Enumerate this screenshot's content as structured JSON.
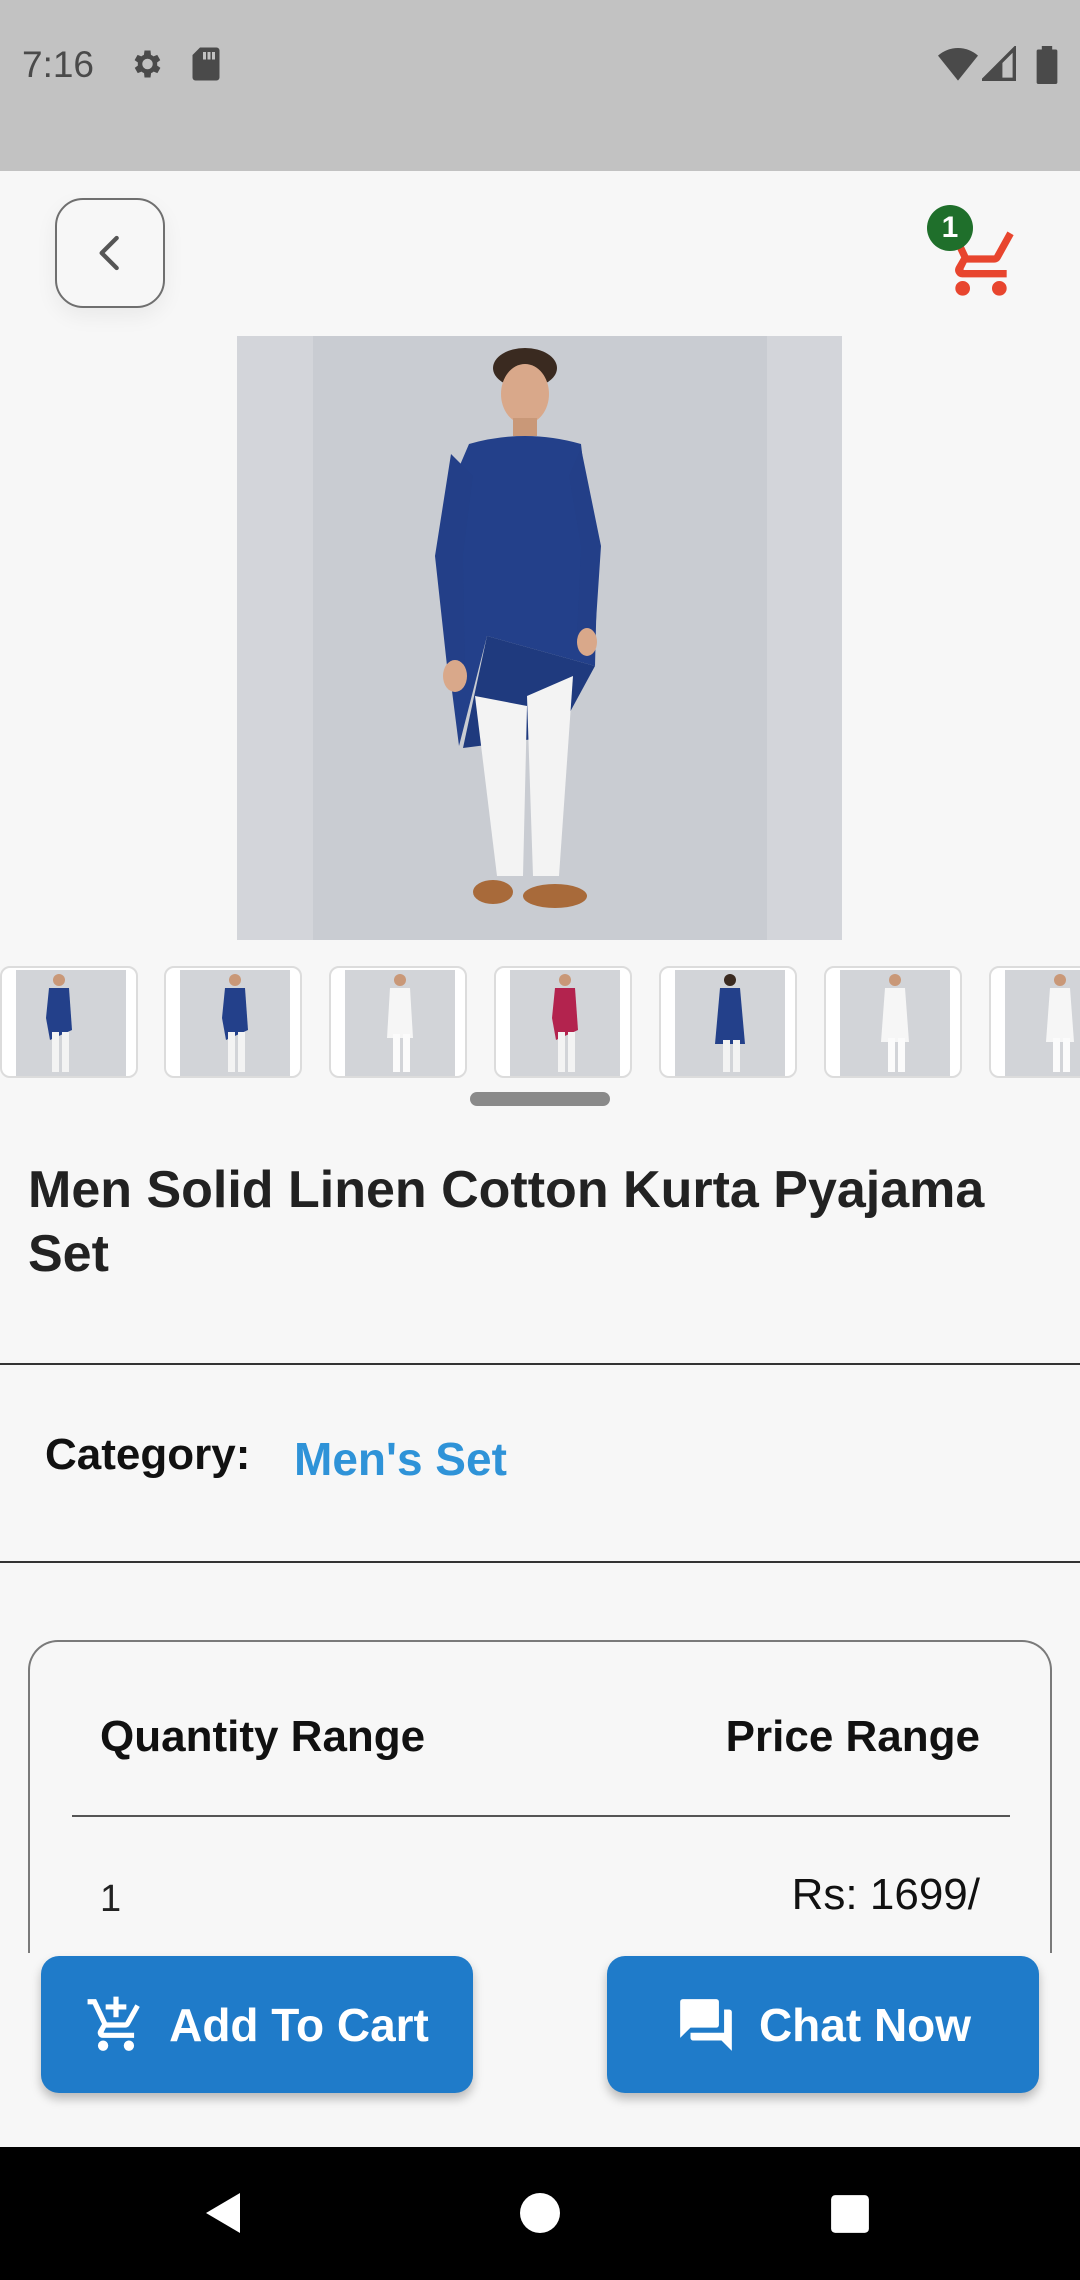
{
  "status_bar": {
    "time": "7:16",
    "icons": [
      "gear-icon",
      "sd-card-icon",
      "wifi-icon",
      "signal-icon",
      "battery-icon"
    ]
  },
  "header": {
    "back_icon": "chevron-left-icon",
    "cart_icon": "shopping-cart-icon",
    "cart_count": "1",
    "cart_color": "#e8452e",
    "badge_color": "#1f6f2b"
  },
  "gallery": {
    "main_image": "product-photo-blue-kurta",
    "thumbnails": [
      {
        "color": "blue"
      },
      {
        "color": "blue"
      },
      {
        "color": "white"
      },
      {
        "color": "maroon"
      },
      {
        "color": "blue"
      },
      {
        "color": "white"
      },
      {
        "color": "white"
      }
    ]
  },
  "product": {
    "title": "Men Solid Linen Cotton Kurta Pyajama Set"
  },
  "category": {
    "label": "Category:",
    "value": "Men's Set"
  },
  "pricing": {
    "quantity_header": "Quantity Range",
    "price_header": "Price Range",
    "rows": [
      {
        "quantity": "1",
        "price": "Rs: 1699/"
      }
    ]
  },
  "actions": {
    "add_to_cart": "Add To Cart",
    "chat_now": "Chat Now",
    "accent": "#1f7bc9"
  },
  "nav": {
    "icons": [
      "back-triangle-icon",
      "home-circle-icon",
      "recents-square-icon"
    ]
  }
}
